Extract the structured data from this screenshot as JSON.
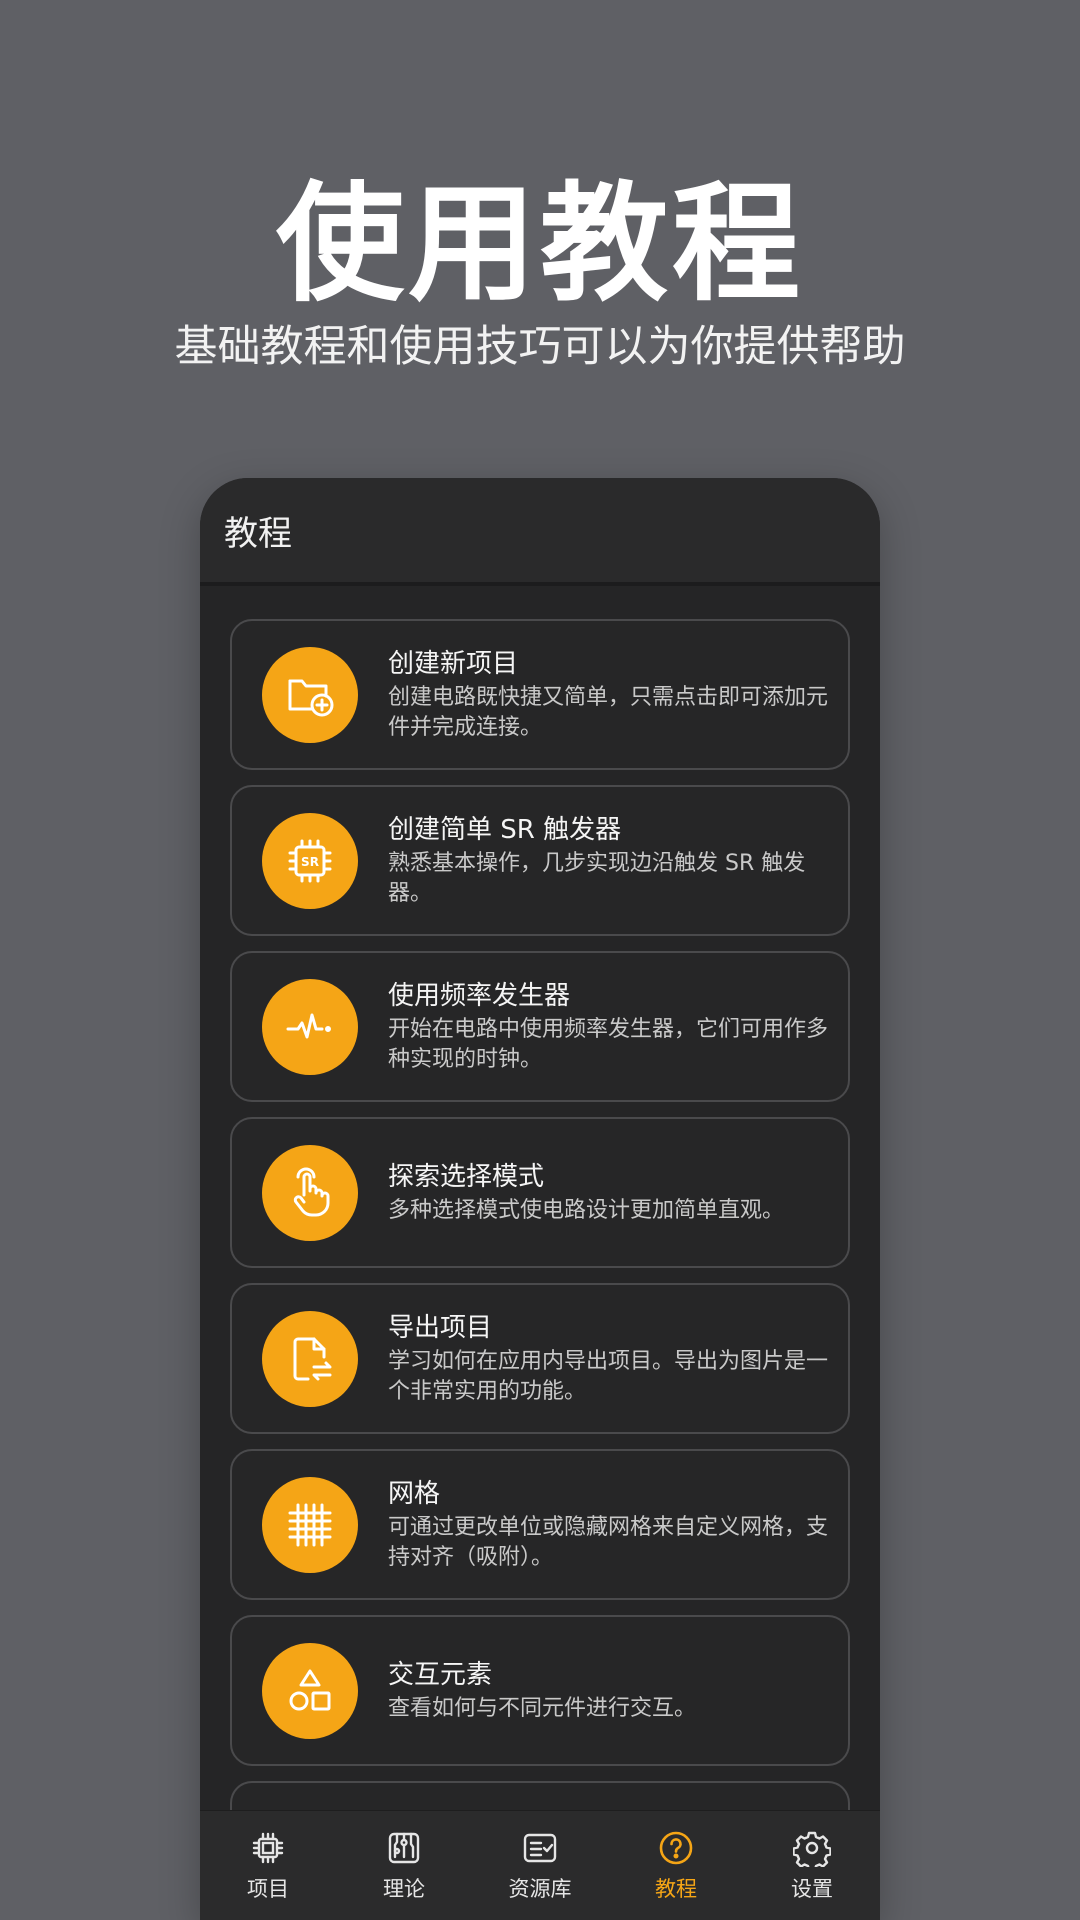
{
  "hero": {
    "title": "使用教程",
    "subtitle": "基础教程和使用技巧可以为你提供帮助"
  },
  "app_bar": {
    "title": "教程"
  },
  "tutorials": [
    {
      "icon": "folder-add-icon",
      "title": "创建新项目",
      "desc": "创建电路既快捷又简单，只需点击即可添加元件并完成连接。"
    },
    {
      "icon": "sr-chip-icon",
      "title": "创建简单 SR 触发器",
      "desc": "熟悉基本操作，几步实现边沿触发 SR 触发器。"
    },
    {
      "icon": "pulse-wave-icon",
      "title": "使用频率发生器",
      "desc": "开始在电路中使用频率发生器，它们可用作多种实现的时钟。"
    },
    {
      "icon": "hand-pointer-icon",
      "title": "探索选择模式",
      "desc": "多种选择模式使电路设计更加简单直观。"
    },
    {
      "icon": "file-export-icon",
      "title": "导出项目",
      "desc": "学习如何在应用内导出项目。导出为图片是一个非常实用的功能。"
    },
    {
      "icon": "grid-icon",
      "title": "网格",
      "desc": "可通过更改单位或隐藏网格来自定义网格，支持对齐（吸附）。"
    },
    {
      "icon": "shapes-icon",
      "title": "交互元素",
      "desc": "查看如何与不同元件进行交互。"
    }
  ],
  "nav": [
    {
      "icon": "chip-icon",
      "label": "项目",
      "active": false
    },
    {
      "icon": "circuit-board-icon",
      "label": "理论",
      "active": false
    },
    {
      "icon": "checklist-icon",
      "label": "资源库",
      "active": false
    },
    {
      "icon": "help-circle-icon",
      "label": "教程",
      "active": true
    },
    {
      "icon": "gear-icon",
      "label": "设置",
      "active": false
    }
  ],
  "colors": {
    "background": "#5f6065",
    "panel": "#252526",
    "accent": "#f5a516",
    "card_border": "#4a4a4c"
  }
}
